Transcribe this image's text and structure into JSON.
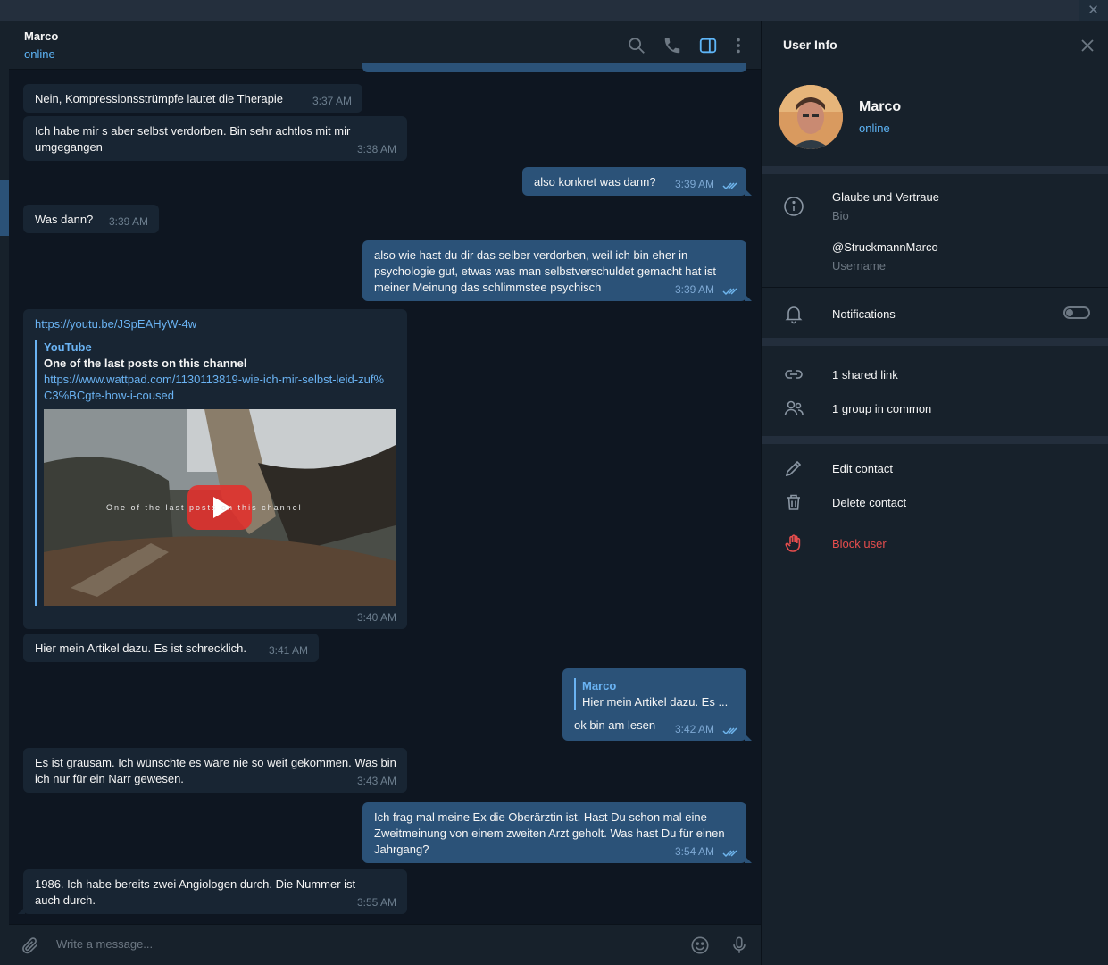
{
  "window": {
    "close_glyph": "✕"
  },
  "chat_header": {
    "name": "Marco",
    "status": "online"
  },
  "messages": [
    {
      "dir": "in",
      "text": "Nein, Kompressionsstrümpfe lautet die Therapie",
      "time": "3:37 AM"
    },
    {
      "dir": "in",
      "text": "Ich habe mir s aber selbst verdorben. Bin sehr achtlos mit mir umgegangen",
      "time": "3:38 AM"
    },
    {
      "dir": "out",
      "text": "also konkret was dann?",
      "time": "3:39 AM"
    },
    {
      "dir": "in",
      "text": "Was dann?",
      "time": "3:39 AM"
    },
    {
      "dir": "out",
      "text": "also wie hast du dir das selber verdorben, weil ich bin eher in psychologie gut, etwas was man selbstverschuldet gemacht hat ist meiner Meinung das schlimmstee psychisch",
      "time": "3:39 AM"
    },
    {
      "dir": "in",
      "link": "https://youtu.be/JSpEAHyW-4w",
      "preview_site": "YouTube",
      "preview_title": "One of the last posts on this channel",
      "preview_link": "https://www.wattpad.com/1130113819-wie-ich-mir-selbst-leid-zuf%C3%BCgte-how-i-coused",
      "video_overlay": "One of the last posts on this channel",
      "time": "3:40 AM"
    },
    {
      "dir": "in",
      "text": "Hier mein Artikel dazu. Es ist schrecklich.",
      "time": "3:41 AM"
    },
    {
      "dir": "out",
      "reply_name": "Marco",
      "reply_text": "Hier mein Artikel dazu. Es ...",
      "text": "ok bin am lesen",
      "time": "3:42 AM"
    },
    {
      "dir": "in",
      "text": "Es ist grausam. Ich wünschte es wäre nie so weit gekommen. Was bin ich nur für ein Narr gewesen.",
      "time": "3:43 AM"
    },
    {
      "dir": "out",
      "text": "Ich frag mal meine Ex die Oberärztin ist. Hast Du schon mal eine Zweitmeinung von einem zweiten Arzt geholt. Was hast Du für einen Jahrgang?",
      "time": "3:54 AM"
    },
    {
      "dir": "in",
      "text": "1986. Ich habe bereits zwei Angiologen durch. Die Nummer ist auch durch.",
      "time": "3:55 AM"
    }
  ],
  "composer": {
    "placeholder": "Write a message..."
  },
  "user_info": {
    "title": "User Info",
    "name": "Marco",
    "status": "online",
    "bio": "Glaube und Vertraue",
    "bio_label": "Bio",
    "username": "@StruckmannMarco",
    "username_label": "Username",
    "notifications_label": "Notifications",
    "notifications_on": false,
    "shared_links": "1 shared link",
    "groups_in_common": "1 group in common",
    "edit_contact": "Edit contact",
    "delete_contact": "Delete contact",
    "block_user": "Block user"
  },
  "colors": {
    "accent": "#5eb5f7",
    "outgoing_bubble": "#2b5278",
    "incoming_bubble": "#182533",
    "danger": "#e64d4d",
    "chat_bg": "#0e1621"
  }
}
